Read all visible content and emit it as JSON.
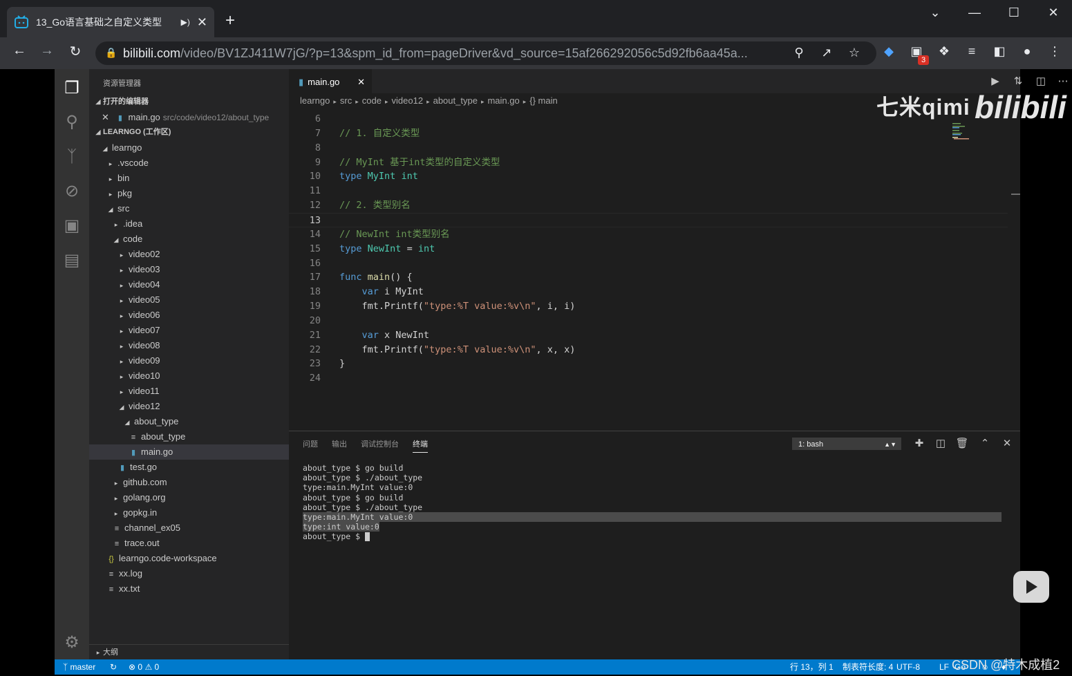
{
  "browser": {
    "tab_title": "13_Go语言基础之自定义类型",
    "new_tab": "+",
    "url_host": "bilibili.com",
    "url_path": "/video/BV1ZJ411W7jG/?p=13&spm_id_from=pageDriver&vd_source=15af266292056c5d92fb6aa45a...",
    "extension_badge": "3",
    "accent": "#202124"
  },
  "vscode": {
    "explorer_title": "资源管理器",
    "open_editors_label": "打开的编辑器",
    "open_editor": {
      "name": "main.go",
      "path": "src/code/video12/about_type"
    },
    "workspace_label": "LEARNGO (工作区)",
    "tree": [
      {
        "label": "learngo",
        "level": 1,
        "kind": "folder-open"
      },
      {
        "label": ".vscode",
        "level": 2,
        "kind": "folder"
      },
      {
        "label": "bin",
        "level": 2,
        "kind": "folder"
      },
      {
        "label": "pkg",
        "level": 2,
        "kind": "folder"
      },
      {
        "label": "src",
        "level": 2,
        "kind": "folder-open"
      },
      {
        "label": ".idea",
        "level": 3,
        "kind": "folder"
      },
      {
        "label": "code",
        "level": 3,
        "kind": "folder-open"
      },
      {
        "label": "video02",
        "level": 4,
        "kind": "folder"
      },
      {
        "label": "video03",
        "level": 4,
        "kind": "folder"
      },
      {
        "label": "video04",
        "level": 4,
        "kind": "folder"
      },
      {
        "label": "video05",
        "level": 4,
        "kind": "folder"
      },
      {
        "label": "video06",
        "level": 4,
        "kind": "folder"
      },
      {
        "label": "video07",
        "level": 4,
        "kind": "folder"
      },
      {
        "label": "video08",
        "level": 4,
        "kind": "folder"
      },
      {
        "label": "video09",
        "level": 4,
        "kind": "folder"
      },
      {
        "label": "video10",
        "level": 4,
        "kind": "folder"
      },
      {
        "label": "video11",
        "level": 4,
        "kind": "folder"
      },
      {
        "label": "video12",
        "level": 4,
        "kind": "folder-open"
      },
      {
        "label": "about_type",
        "level": 5,
        "kind": "folder-open"
      },
      {
        "label": "about_type",
        "level": 6,
        "kind": "file"
      },
      {
        "label": "main.go",
        "level": 6,
        "kind": "go",
        "selected": true
      },
      {
        "label": "test.go",
        "level": 4,
        "kind": "go"
      },
      {
        "label": "github.com",
        "level": 3,
        "kind": "folder"
      },
      {
        "label": "golang.org",
        "level": 3,
        "kind": "folder"
      },
      {
        "label": "gopkg.in",
        "level": 3,
        "kind": "folder"
      },
      {
        "label": "channel_ex05",
        "level": 3,
        "kind": "file"
      },
      {
        "label": "trace.out",
        "level": 3,
        "kind": "file"
      },
      {
        "label": "learngo.code-workspace",
        "level": 2,
        "kind": "workspace"
      },
      {
        "label": "xx.log",
        "level": 2,
        "kind": "file"
      },
      {
        "label": "xx.txt",
        "level": 2,
        "kind": "file"
      }
    ],
    "outline_label": "大纲",
    "editor_tab": "main.go",
    "breadcrumbs": [
      "learngo",
      "src",
      "code",
      "video12",
      "about_type",
      "main.go",
      "{} main"
    ],
    "current_line": 13,
    "code_lines": [
      {
        "n": 6,
        "tokens": []
      },
      {
        "n": 7,
        "tokens": [
          [
            "com",
            "// 1. 自定义类型"
          ]
        ]
      },
      {
        "n": 8,
        "tokens": []
      },
      {
        "n": 9,
        "tokens": [
          [
            "com",
            "// MyInt 基于int类型的自定义类型"
          ]
        ]
      },
      {
        "n": 10,
        "tokens": [
          [
            "kw",
            "type"
          ],
          [
            "pl",
            " "
          ],
          [
            "ty",
            "MyInt"
          ],
          [
            "pl",
            " "
          ],
          [
            "ty",
            "int"
          ]
        ]
      },
      {
        "n": 11,
        "tokens": []
      },
      {
        "n": 12,
        "tokens": [
          [
            "com",
            "// 2. 类型别名"
          ]
        ]
      },
      {
        "n": 13,
        "tokens": []
      },
      {
        "n": 14,
        "tokens": [
          [
            "com",
            "// NewInt int类型别名"
          ]
        ]
      },
      {
        "n": 15,
        "tokens": [
          [
            "kw",
            "type"
          ],
          [
            "pl",
            " "
          ],
          [
            "ty",
            "NewInt"
          ],
          [
            "pl",
            " = "
          ],
          [
            "ty",
            "int"
          ]
        ]
      },
      {
        "n": 16,
        "tokens": []
      },
      {
        "n": 17,
        "tokens": [
          [
            "kw",
            "func"
          ],
          [
            "pl",
            " "
          ],
          [
            "fn",
            "main"
          ],
          [
            "pl",
            "() {"
          ]
        ]
      },
      {
        "n": 18,
        "tokens": [
          [
            "pl",
            "    "
          ],
          [
            "kw",
            "var"
          ],
          [
            "pl",
            " i MyInt"
          ]
        ]
      },
      {
        "n": 19,
        "tokens": [
          [
            "pl",
            "    fmt.Printf("
          ],
          [
            "str",
            "\"type:%T value:%v\\n\""
          ],
          [
            "pl",
            ", i, i)"
          ]
        ]
      },
      {
        "n": 20,
        "tokens": []
      },
      {
        "n": 21,
        "tokens": [
          [
            "pl",
            "    "
          ],
          [
            "kw",
            "var"
          ],
          [
            "pl",
            " x NewInt"
          ]
        ]
      },
      {
        "n": 22,
        "tokens": [
          [
            "pl",
            "    fmt.Printf("
          ],
          [
            "str",
            "\"type:%T value:%v\\n\""
          ],
          [
            "pl",
            ", x, x)"
          ]
        ]
      },
      {
        "n": 23,
        "tokens": [
          [
            "pl",
            "}"
          ]
        ]
      },
      {
        "n": 24,
        "tokens": []
      }
    ],
    "panel_tabs": [
      "问题",
      "输出",
      "调试控制台",
      "终端"
    ],
    "terminal_select": "1: bash",
    "terminal_lines": [
      "about_type $ go build",
      "about_type $ ./about_type",
      "type:main.MyInt value:0",
      "about_type $ go build",
      "about_type $ ./about_type",
      "type:main.MyInt value:0",
      "type:int value:0",
      "about_type $ "
    ],
    "status": {
      "branch": "master",
      "errors": "0",
      "warnings": "0",
      "position": "行 13，列 1",
      "tab_size": "制表符长度: 4",
      "encoding": "UTF-8",
      "eol": "LF",
      "lang": "Go"
    }
  },
  "overlay": {
    "watermark_text": "七米qimi",
    "logo_text": "bilibili",
    "csdn_text": "CSDN @特木成植2"
  }
}
